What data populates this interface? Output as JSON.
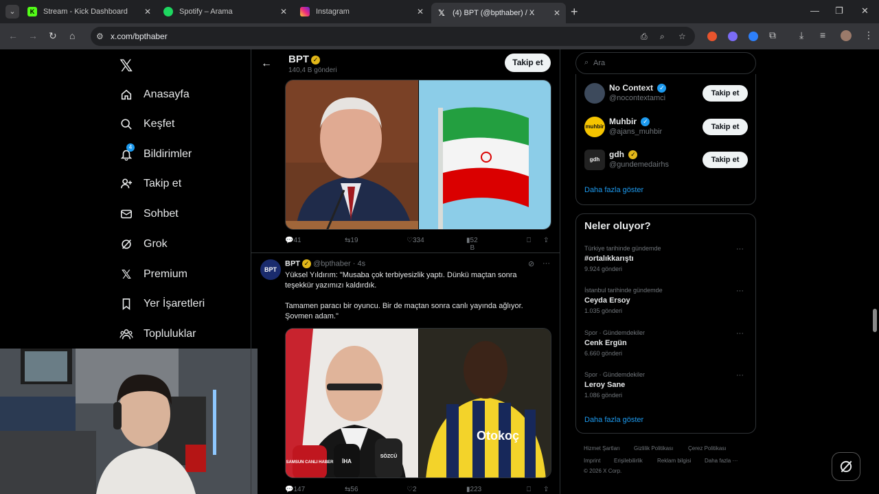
{
  "browser": {
    "tabs": [
      {
        "title": "Stream - Kick Dashboard",
        "icon": "kick-icon",
        "color": "#53fc18"
      },
      {
        "title": "Spotify – Arama",
        "icon": "spotify-icon",
        "color": "#1ed760"
      },
      {
        "title": "Instagram",
        "icon": "instagram-icon",
        "color": "#e1306c"
      },
      {
        "title": "(4) BPT (@bpthaber) / X",
        "icon": "x-icon",
        "color": "#ffffff"
      }
    ],
    "url": "x.com/bpthaber"
  },
  "nav": {
    "items": [
      {
        "label": "Anasayfa",
        "icon": "home-icon"
      },
      {
        "label": "Keşfet",
        "icon": "search-icon"
      },
      {
        "label": "Bildirimler",
        "icon": "bell-icon",
        "badge": "4"
      },
      {
        "label": "Takip et",
        "icon": "follow-icon"
      },
      {
        "label": "Sohbet",
        "icon": "mail-icon"
      },
      {
        "label": "Grok",
        "icon": "grok-icon"
      },
      {
        "label": "Premium",
        "icon": "x-premium-icon"
      },
      {
        "label": "Yer İşaretleri",
        "icon": "bookmark-icon"
      },
      {
        "label": "Topluluklar",
        "icon": "communities-icon"
      }
    ]
  },
  "profile": {
    "name": "BPT",
    "post_count": "140,4 B gönderi",
    "follow_label": "Takip et"
  },
  "tweet1": {
    "stats": {
      "replies": "41",
      "reposts": "19",
      "likes": "334",
      "views": "52 B"
    }
  },
  "tweet2": {
    "name": "BPT",
    "handle": "@bpthaber",
    "time": "4s",
    "avatar_text": "BPT",
    "text_line1": "Yüksel Yıldırım: \"Musaba çok terbiyesizlik yaptı. Dünkü maçtan sonra",
    "text_line2": "teşekkür yazımızı kaldırdık.",
    "text_line3": "Tamamen paracı bir oyuncu. Bir de maçtan sonra canlı yayında ağlıyor.",
    "text_line4": "Şovmen adam.\"",
    "stats": {
      "replies": "147",
      "reposts": "56",
      "likes": "2 B",
      "views": "223 B"
    },
    "mic_labels": [
      "SAMSUN CANLI HABER",
      "İHA",
      "SÖZCÜ"
    ],
    "jersey_text": "Otokoç"
  },
  "search": {
    "placeholder": "Ara"
  },
  "who_to_follow": {
    "items": [
      {
        "name": "No Context",
        "handle": "@nocontextamci",
        "verified": "blue",
        "avatar_text": ""
      },
      {
        "name": "Muhbir",
        "handle": "@ajans_muhbir",
        "verified": "blue",
        "avatar_text": "muhbir"
      },
      {
        "name": "gdh",
        "handle": "@gundemedairhs",
        "verified": "gold",
        "avatar_text": "gdh"
      }
    ],
    "follow_label": "Takip et",
    "show_more": "Daha fazla göster"
  },
  "trends": {
    "title": "Neler oluyor?",
    "items": [
      {
        "context": "Türkiye tarihinde gündemde",
        "title": "#ortalıkkarıştı",
        "count": "9.924 gönderi"
      },
      {
        "context": "İstanbul tarihinde gündemde",
        "title": "Ceyda Ersoy",
        "count": "1.035 gönderi"
      },
      {
        "context": "Spor · Gündemdekiler",
        "title": "Cenk Ergün",
        "count": "6.660 gönderi"
      },
      {
        "context": "Spor · Gündemdekiler",
        "title": "Leroy Sane",
        "count": "1.086 gönderi"
      }
    ],
    "show_more": "Daha fazla göster"
  },
  "footer": {
    "links": [
      "Hizmet Şartları",
      "Gizlilik Politikası",
      "Çerez Politikası",
      "Imprint",
      "Erişilebilirlik",
      "Reklam bilgisi",
      "Daha fazla ···"
    ],
    "copyright": "© 2026 X Corp."
  }
}
